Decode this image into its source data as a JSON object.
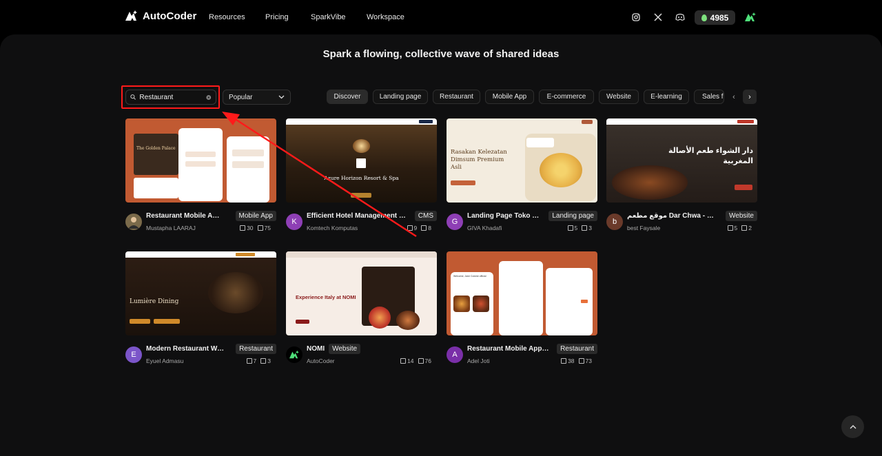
{
  "nav": {
    "brand": "AutoCoder",
    "links": [
      "Resources",
      "Pricing",
      "SparkVibe",
      "Workspace"
    ],
    "icons": [
      "instagram-icon",
      "x-icon",
      "discord-icon"
    ],
    "credits": "4985"
  },
  "headline": "Spark a flowing, collective wave of shared ideas",
  "search": {
    "value": "Restaurant",
    "placeholder": "Search"
  },
  "sort": {
    "selected": "Popular"
  },
  "categories": [
    "Discover",
    "Landing page",
    "Restaurant",
    "Mobile App",
    "E-commerce",
    "Website",
    "E-learning",
    "Sales f"
  ],
  "cards": [
    {
      "title": "Restaurant Mobile App",
      "tag": "Mobile App",
      "author": "Mustapha LAARAJ",
      "likes": "30",
      "copies": "75",
      "avatar": "",
      "avatar_color": "#7a6a4a",
      "thumb_bg": "#c15a32",
      "thumb_text": "The Golden Palace"
    },
    {
      "title": "Efficient Hotel Management Sys...",
      "tag": "CMS",
      "author": "Komtech Komputas",
      "likes": "9",
      "copies": "8",
      "avatar": "K",
      "avatar_color": "#8e3fb5",
      "thumb_bg": "#3a2a18",
      "thumb_text": "Azure Horizon Resort & Spa"
    },
    {
      "title": "Landing Page Toko Dim...",
      "tag": "Landing page",
      "author": "GIVA Khadafi",
      "likes": "5",
      "copies": "3",
      "avatar": "G",
      "avatar_color": "#8e3fb5",
      "thumb_bg": "#f3ecdf",
      "thumb_text": "Rasakan Kelezatan Dimsum Premium Asli"
    },
    {
      "title": "موقع مطعم Dar Chwa - الناظور",
      "tag": "Website",
      "author": "best Faysale",
      "likes": "5",
      "copies": "2",
      "avatar": "b",
      "avatar_color": "#6a3a2a",
      "thumb_bg": "#2a2320",
      "thumb_text": "دار الشواء طعم الأصالة المغربية"
    },
    {
      "title": "Modern Restaurant Webs...",
      "tag": "Restaurant",
      "author": "Eyuel Admasu",
      "likes": "7",
      "copies": "3",
      "avatar": "E",
      "avatar_color": "#7b55c9",
      "thumb_bg": "#2a1c14",
      "thumb_text": "Lumière Dining"
    },
    {
      "title": "NOMI",
      "tag": "Website",
      "author": "AutoCoder",
      "likes": "14",
      "copies": "76",
      "avatar": "",
      "avatar_color": "#000000",
      "thumb_bg": "#f6ede6",
      "thumb_text": "Experience Italy at NOMI"
    },
    {
      "title": "Restaurant Mobile App Pl...",
      "tag": "Restaurant",
      "author": "Adel Joti",
      "likes": "38",
      "copies": "73",
      "avatar": "A",
      "avatar_color": "#7a2fa8",
      "thumb_bg": "#c15a32",
      "thumb_text": "Welcome, Jane Cuisine official"
    }
  ]
}
